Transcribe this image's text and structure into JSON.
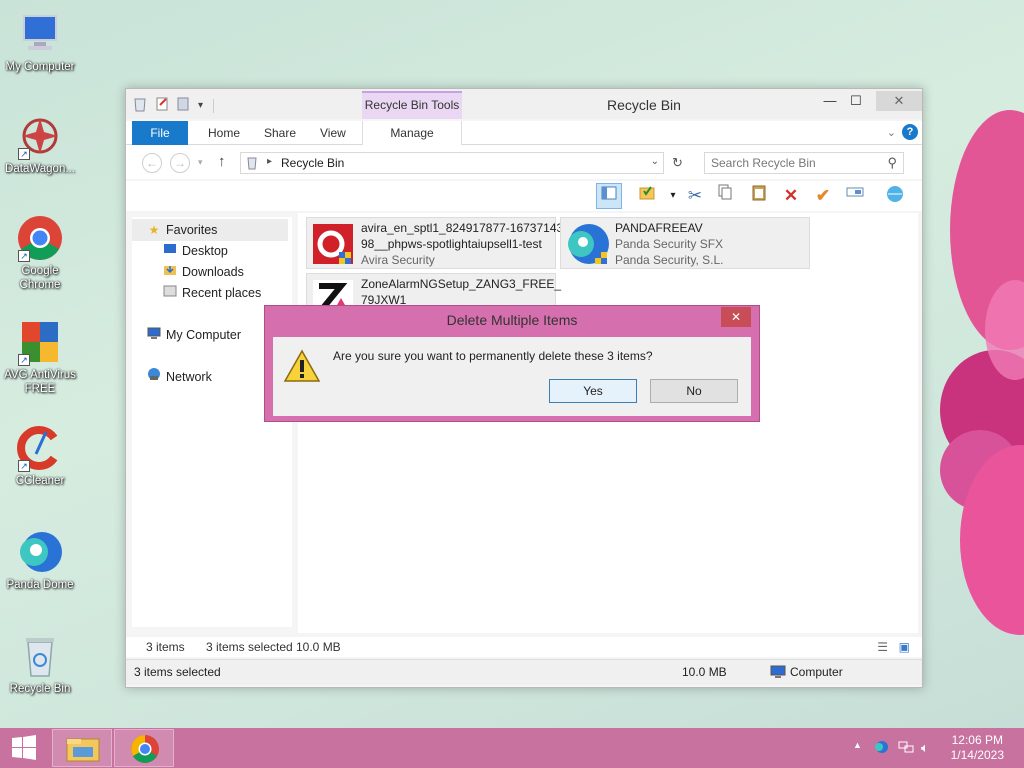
{
  "desktop": {
    "icons": [
      {
        "label": "My Computer"
      },
      {
        "label": "DataWagon..."
      },
      {
        "label": "Google Chrome"
      },
      {
        "label": "AVG AntiVirus FREE"
      },
      {
        "label": "CCleaner"
      },
      {
        "label": "Panda Dome"
      },
      {
        "label": "Recycle Bin"
      }
    ]
  },
  "window": {
    "title": "Recycle Bin",
    "context_tab_group": "Recycle Bin Tools",
    "tabs": [
      "File",
      "Home",
      "Share",
      "View",
      "Manage"
    ],
    "address": "Recycle Bin",
    "search_placeholder": "Search Recycle Bin",
    "nav": {
      "favorites": "Favorites",
      "desktop": "Desktop",
      "downloads": "Downloads",
      "recent": "Recent places",
      "computer": "My Computer",
      "network": "Network"
    },
    "files": [
      {
        "line1": "avira_en_sptl1_824917877-16737143",
        "line2": "98__phpws-spotlightaiupsell1-test",
        "line3": "Avira Security"
      },
      {
        "line1": "PANDAFREEAV",
        "line2": "Panda Security SFX",
        "line3": "Panda Security, S.L."
      },
      {
        "line1": "ZoneAlarmNGSetup_ZANG3_FREE_",
        "line2": "79JXW1",
        "line3": ""
      }
    ],
    "status": {
      "count": "3 items",
      "selected": "3 items selected",
      "size": "10.0 MB"
    },
    "details": {
      "selected": "3 items selected",
      "size": "10.0 MB",
      "location": "Computer"
    }
  },
  "dialog": {
    "title": "Delete Multiple Items",
    "message": "Are you sure you want to permanently delete these 3 items?",
    "yes": "Yes",
    "no": "No"
  },
  "taskbar": {
    "time": "12:06 PM",
    "date": "1/14/2023"
  }
}
